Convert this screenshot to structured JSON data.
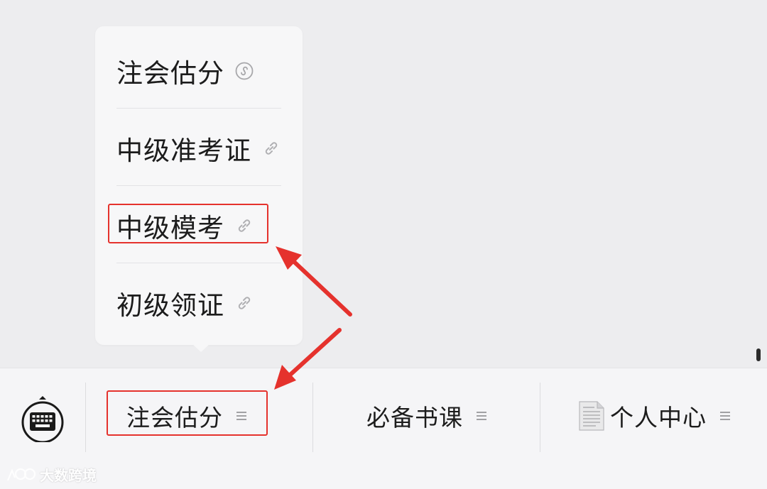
{
  "popup_menu": {
    "items": [
      {
        "label": "注会估分",
        "icon": "miniprogram-icon"
      },
      {
        "label": "中级准考证",
        "icon": "link-icon"
      },
      {
        "label": "中级模考",
        "icon": "link-icon"
      },
      {
        "label": "初级领证",
        "icon": "link-icon"
      }
    ]
  },
  "bottom_bar": {
    "keyboard_icon": "keyboard-icon",
    "tabs": [
      {
        "label": "注会估分",
        "icon": "menu-lines-icon"
      },
      {
        "label": "必备书课",
        "icon": "menu-lines-icon"
      },
      {
        "label": "个人中心",
        "leading_icon": "document-icon",
        "icon": "menu-lines-icon"
      }
    ]
  },
  "watermark": {
    "text": "大数跨境"
  },
  "colors": {
    "annotation": "#e5322d",
    "background": "#ededef",
    "menu_background": "#f7f7f8",
    "bar_background": "#f5f5f7"
  }
}
